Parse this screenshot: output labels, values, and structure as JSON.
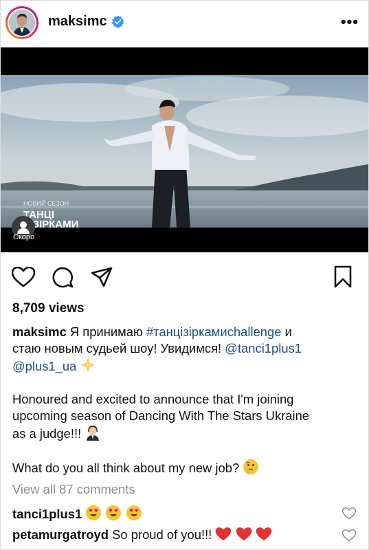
{
  "post": {
    "username": "maksimc",
    "more_label": "•••",
    "views": "8,709 views"
  },
  "video": {
    "overlay_small": "НОВИЙ СЕЗОН",
    "overlay_line1": "ТАНЦІ",
    "overlay_line2": "З ЗІРКАМИ",
    "chip_label": "Скоро"
  },
  "caption": {
    "user": "maksimc",
    "text1": " Я принимаю ",
    "hashtag": "#танцізірками",
    "hashtag2": "challenge",
    "text2": " и",
    "line2_text": "стаю новым судьей шоу! Увидимся! ",
    "mention1": "@tanci1plus1",
    "mention2": "@plus1_ua",
    "para2_line1": "Honoured and excited to announce that I'm joining",
    "para2_line2": "upcoming season of Dancing With The Stars Ukraine",
    "para2_line3": "as a judge!!! ",
    "para3": "What do you all think about my new job? "
  },
  "comments": {
    "view_all": "View all 87 comments",
    "items": [
      {
        "user": "tanci1plus1",
        "text": ""
      },
      {
        "user": "petamurgatroyd",
        "text": " So proud of you!!! "
      }
    ]
  },
  "icons": [
    "verified-badge-icon",
    "heart-icon",
    "comment-icon",
    "share-icon",
    "bookmark-icon",
    "sparkle-emoji-icon",
    "man-judge-emoji-icon",
    "thinking-emoji-icon",
    "heart-eyes-emoji-icon",
    "red-heart-emoji-icon"
  ],
  "colors": {
    "link": "#1d4f85",
    "verified": "#3897f0",
    "muted": "#8e8e8e"
  }
}
